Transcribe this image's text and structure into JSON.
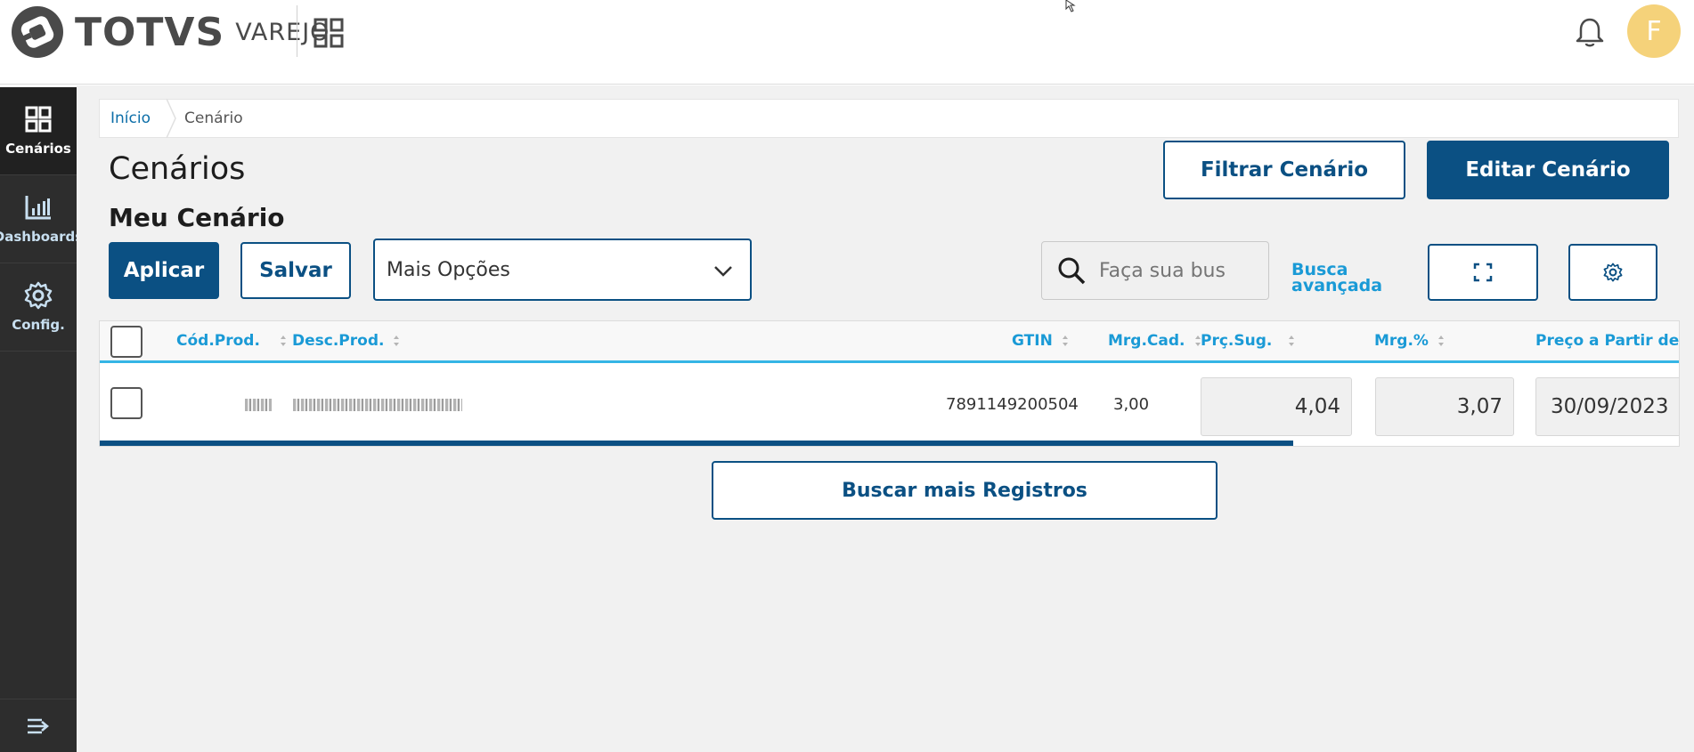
{
  "header": {
    "brand": "TOTVS",
    "brand_sub": "VAREJO",
    "avatar_initial": "F"
  },
  "sidebar": {
    "items": [
      {
        "label": "Cenários",
        "icon": "grid-icon",
        "active": true
      },
      {
        "label": "Dashboards",
        "icon": "bar-chart-icon",
        "active": false
      },
      {
        "label": "Config.",
        "icon": "gear-icon",
        "active": false
      }
    ],
    "collapse_icon": "menu-collapse-icon"
  },
  "breadcrumb": {
    "home": "Início",
    "current": "Cenário"
  },
  "page": {
    "title": "Cenários",
    "section": "Meu Cenário"
  },
  "buttons": {
    "filter": "Filtrar Cenário",
    "edit": "Editar Cenário",
    "apply": "Aplicar",
    "save": "Salvar",
    "more_records": "Buscar mais Registros"
  },
  "options_select": {
    "value": "Mais Opções"
  },
  "search": {
    "placeholder": "Faça sua bus",
    "advanced": "Busca avançada"
  },
  "table": {
    "columns": [
      "Cód.Prod.",
      "Desc.Prod.",
      "GTIN",
      "Mrg.Cad.",
      "Prç.Sug.",
      "Mrg.%",
      "Preço a Partir de"
    ],
    "rows": [
      {
        "gtin": "7891149200504",
        "mrg_cad": "3,00",
        "prc_sug": "4,04",
        "mrg_pct": "3,07",
        "preco_a_partir": "30/09/2023"
      }
    ]
  },
  "colors": {
    "primary": "#0b5083",
    "accent": "#1a9ad6",
    "sidebar": "#2d2d2d",
    "avatar": "#f5d27a"
  }
}
